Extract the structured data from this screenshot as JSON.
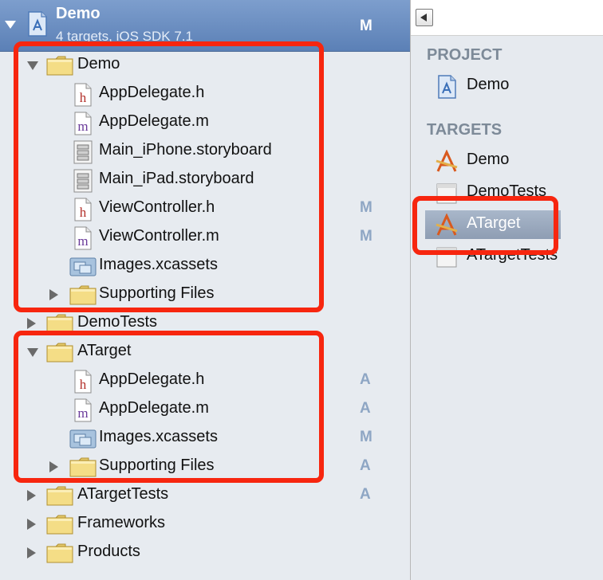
{
  "project": {
    "name": "Demo",
    "subtitle": "4 targets, iOS SDK 7.1",
    "badge": "M"
  },
  "navigator_rows": [
    {
      "label": "Demo",
      "kind": "folder",
      "disclosure": "expanded",
      "badge": ""
    },
    {
      "label": "AppDelegate.h",
      "kind": "header-file",
      "disclosure": "none",
      "badge": ""
    },
    {
      "label": "AppDelegate.m",
      "kind": "implementation-file",
      "disclosure": "none",
      "badge": ""
    },
    {
      "label": "Main_iPhone.storyboard",
      "kind": "storyboard-file",
      "disclosure": "none",
      "badge": ""
    },
    {
      "label": "Main_iPad.storyboard",
      "kind": "storyboard-file",
      "disclosure": "none",
      "badge": ""
    },
    {
      "label": "ViewController.h",
      "kind": "header-file",
      "disclosure": "none",
      "badge": "M"
    },
    {
      "label": "ViewController.m",
      "kind": "implementation-file",
      "disclosure": "none",
      "badge": "M"
    },
    {
      "label": "Images.xcassets",
      "kind": "asset-catalog",
      "disclosure": "none",
      "badge": ""
    },
    {
      "label": "Supporting Files",
      "kind": "folder",
      "disclosure": "collapsed",
      "badge": ""
    },
    {
      "label": "DemoTests",
      "kind": "folder",
      "disclosure": "collapsed",
      "badge": ""
    },
    {
      "label": "ATarget",
      "kind": "folder",
      "disclosure": "expanded",
      "badge": ""
    },
    {
      "label": "AppDelegate.h",
      "kind": "header-file",
      "disclosure": "none",
      "badge": "A"
    },
    {
      "label": "AppDelegate.m",
      "kind": "implementation-file",
      "disclosure": "none",
      "badge": "A"
    },
    {
      "label": "Images.xcassets",
      "kind": "asset-catalog",
      "disclosure": "none",
      "badge": "M"
    },
    {
      "label": "Supporting Files",
      "kind": "folder",
      "disclosure": "collapsed",
      "badge": "A"
    },
    {
      "label": "ATargetTests",
      "kind": "folder",
      "disclosure": "collapsed",
      "badge": "A"
    },
    {
      "label": "Frameworks",
      "kind": "folder",
      "disclosure": "collapsed",
      "badge": ""
    },
    {
      "label": "Products",
      "kind": "folder",
      "disclosure": "collapsed",
      "badge": ""
    }
  ],
  "right_panel": {
    "project_header": "PROJECT",
    "project_item": "Demo",
    "targets_header": "TARGETS",
    "targets": [
      {
        "label": "Demo",
        "icon": "app-target-icon",
        "selected": false
      },
      {
        "label": "DemoTests",
        "icon": "test-bundle-icon",
        "selected": false
      },
      {
        "label": "ATarget",
        "icon": "app-target-icon",
        "selected": true
      },
      {
        "label": "ATargetTests",
        "icon": "test-bundle-icon",
        "selected": false
      }
    ]
  },
  "colors": {
    "highlight_border": "#f7260f",
    "project_row": "#6b8ec2",
    "badge": "#8ea6c4",
    "sidebar_bg": "#e7ebf0"
  }
}
